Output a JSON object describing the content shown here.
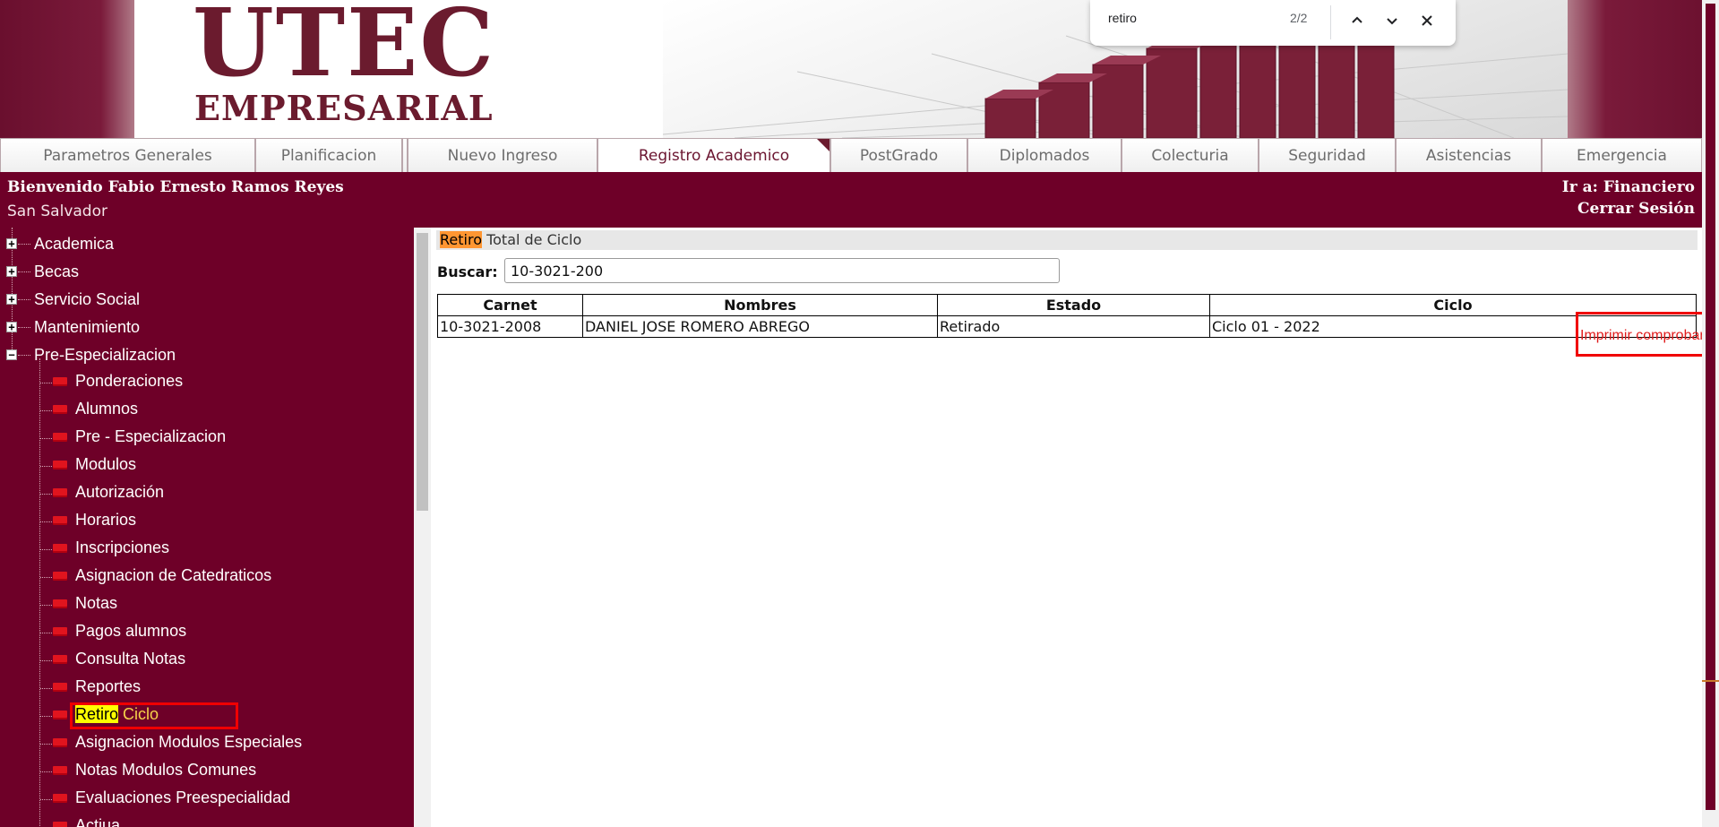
{
  "banner": {
    "logo_line1": "UTEC",
    "logo_line2": "EMPRESARIAL"
  },
  "find_bar": {
    "query": "retiro",
    "count": "2/2",
    "prev_icon": "chevron-up-icon",
    "next_icon": "chevron-down-icon",
    "close_icon": "close-icon"
  },
  "tabs": [
    {
      "label": "Parametros Generales"
    },
    {
      "label": "Planificacion"
    },
    {
      "label": "Nuevo Ingreso"
    },
    {
      "label": "Registro Academico",
      "active": true
    },
    {
      "label": "PostGrado"
    },
    {
      "label": "Diplomados"
    },
    {
      "label": "Colecturia"
    },
    {
      "label": "Seguridad"
    },
    {
      "label": "Asistencias"
    },
    {
      "label": "Emergencia"
    }
  ],
  "header": {
    "welcome": "Bienvenido Fabio Ernesto Ramos Reyes",
    "city": "San Salvador",
    "goto": "Ir a: Financiero",
    "logout": "Cerrar Sesión"
  },
  "sidebar": {
    "top_items": [
      {
        "label": "Academica",
        "toggle": "+"
      },
      {
        "label": "Becas",
        "toggle": "+"
      },
      {
        "label": "Servicio Social",
        "toggle": "+"
      },
      {
        "label": "Mantenimiento",
        "toggle": "+"
      },
      {
        "label": "Pre-Especializacion",
        "toggle": "−"
      }
    ],
    "children": [
      {
        "label": "Ponderaciones"
      },
      {
        "label": "Alumnos"
      },
      {
        "label": "Pre - Especializacion"
      },
      {
        "label": "Modulos"
      },
      {
        "label": "Autorización"
      },
      {
        "label": "Horarios"
      },
      {
        "label": "Inscripciones"
      },
      {
        "label": "Asignacion de Catedraticos"
      },
      {
        "label": "Notas"
      },
      {
        "label": "Pagos alumnos"
      },
      {
        "label": "Consulta Notas"
      },
      {
        "label": "Reportes"
      },
      {
        "label_highlight": "Retiro",
        "label_rest": " Ciclo",
        "selected": true
      },
      {
        "label": "Asignacion Modulos Especiales"
      },
      {
        "label": "Notas Modulos Comunes"
      },
      {
        "label": "Evaluaciones Preespecialidad"
      },
      {
        "label": "Actiua..."
      }
    ]
  },
  "content": {
    "title_highlight": "Retiro",
    "title_rest": " Total de Ciclo",
    "search_label": "Buscar:",
    "search_value": "10-3021-200",
    "table": {
      "headers": [
        "Carnet",
        "Nombres",
        "Estado",
        "Ciclo"
      ],
      "rows": [
        [
          "10-3021-2008",
          "DANIEL JOSE ROMERO ABREGO",
          "Retirado",
          "Ciclo 01 - 2022"
        ]
      ]
    },
    "print_link": "Imprimir comprobante"
  },
  "colors": {
    "brand": "#6e0028",
    "highlight_yellow": "#ffff00",
    "highlight_orange": "#ff9632",
    "annotation_red": "#f00000",
    "link_red": "#e01b1b"
  }
}
